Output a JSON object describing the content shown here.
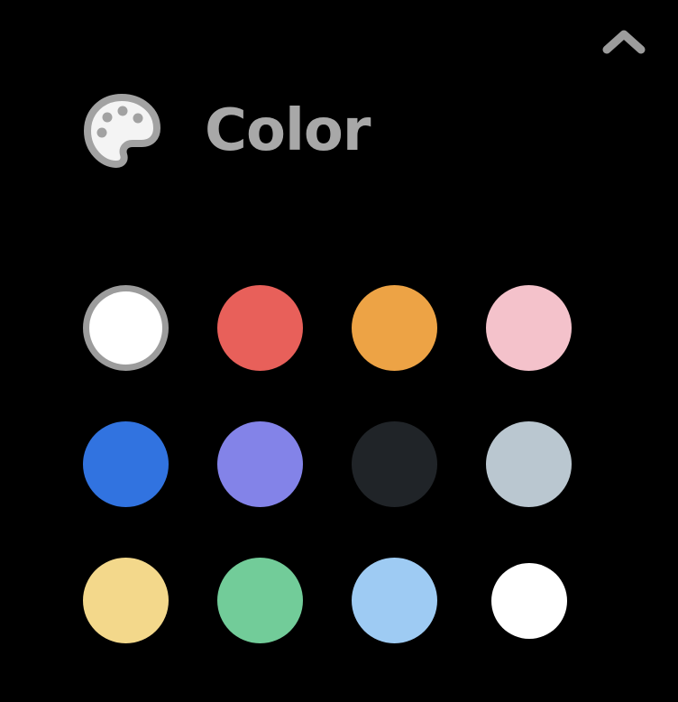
{
  "header": {
    "title": "Color",
    "icon": "palette-icon"
  },
  "collapse_icon": "chevron-up-icon",
  "accent": {
    "title_color": "#a8a8a8",
    "selection_ring": "#9c9c9c"
  },
  "swatches": [
    {
      "id": "white",
      "color": "#ffffff",
      "selected": true
    },
    {
      "id": "red",
      "color": "#e8605a",
      "selected": false
    },
    {
      "id": "orange",
      "color": "#eda345",
      "selected": false
    },
    {
      "id": "pink",
      "color": "#f4c2cb",
      "selected": false
    },
    {
      "id": "blue",
      "color": "#3173e0",
      "selected": false
    },
    {
      "id": "purple",
      "color": "#8383e8",
      "selected": false
    },
    {
      "id": "dark-gray",
      "color": "#202428",
      "selected": false
    },
    {
      "id": "light-gray",
      "color": "#bac7d0",
      "selected": false
    },
    {
      "id": "yellow",
      "color": "#f3d88b",
      "selected": false
    },
    {
      "id": "green",
      "color": "#72cc99",
      "selected": false
    },
    {
      "id": "light-blue",
      "color": "#9ecbf3",
      "selected": false
    },
    {
      "id": "white-2",
      "color": "#ffffff",
      "selected": false
    }
  ]
}
